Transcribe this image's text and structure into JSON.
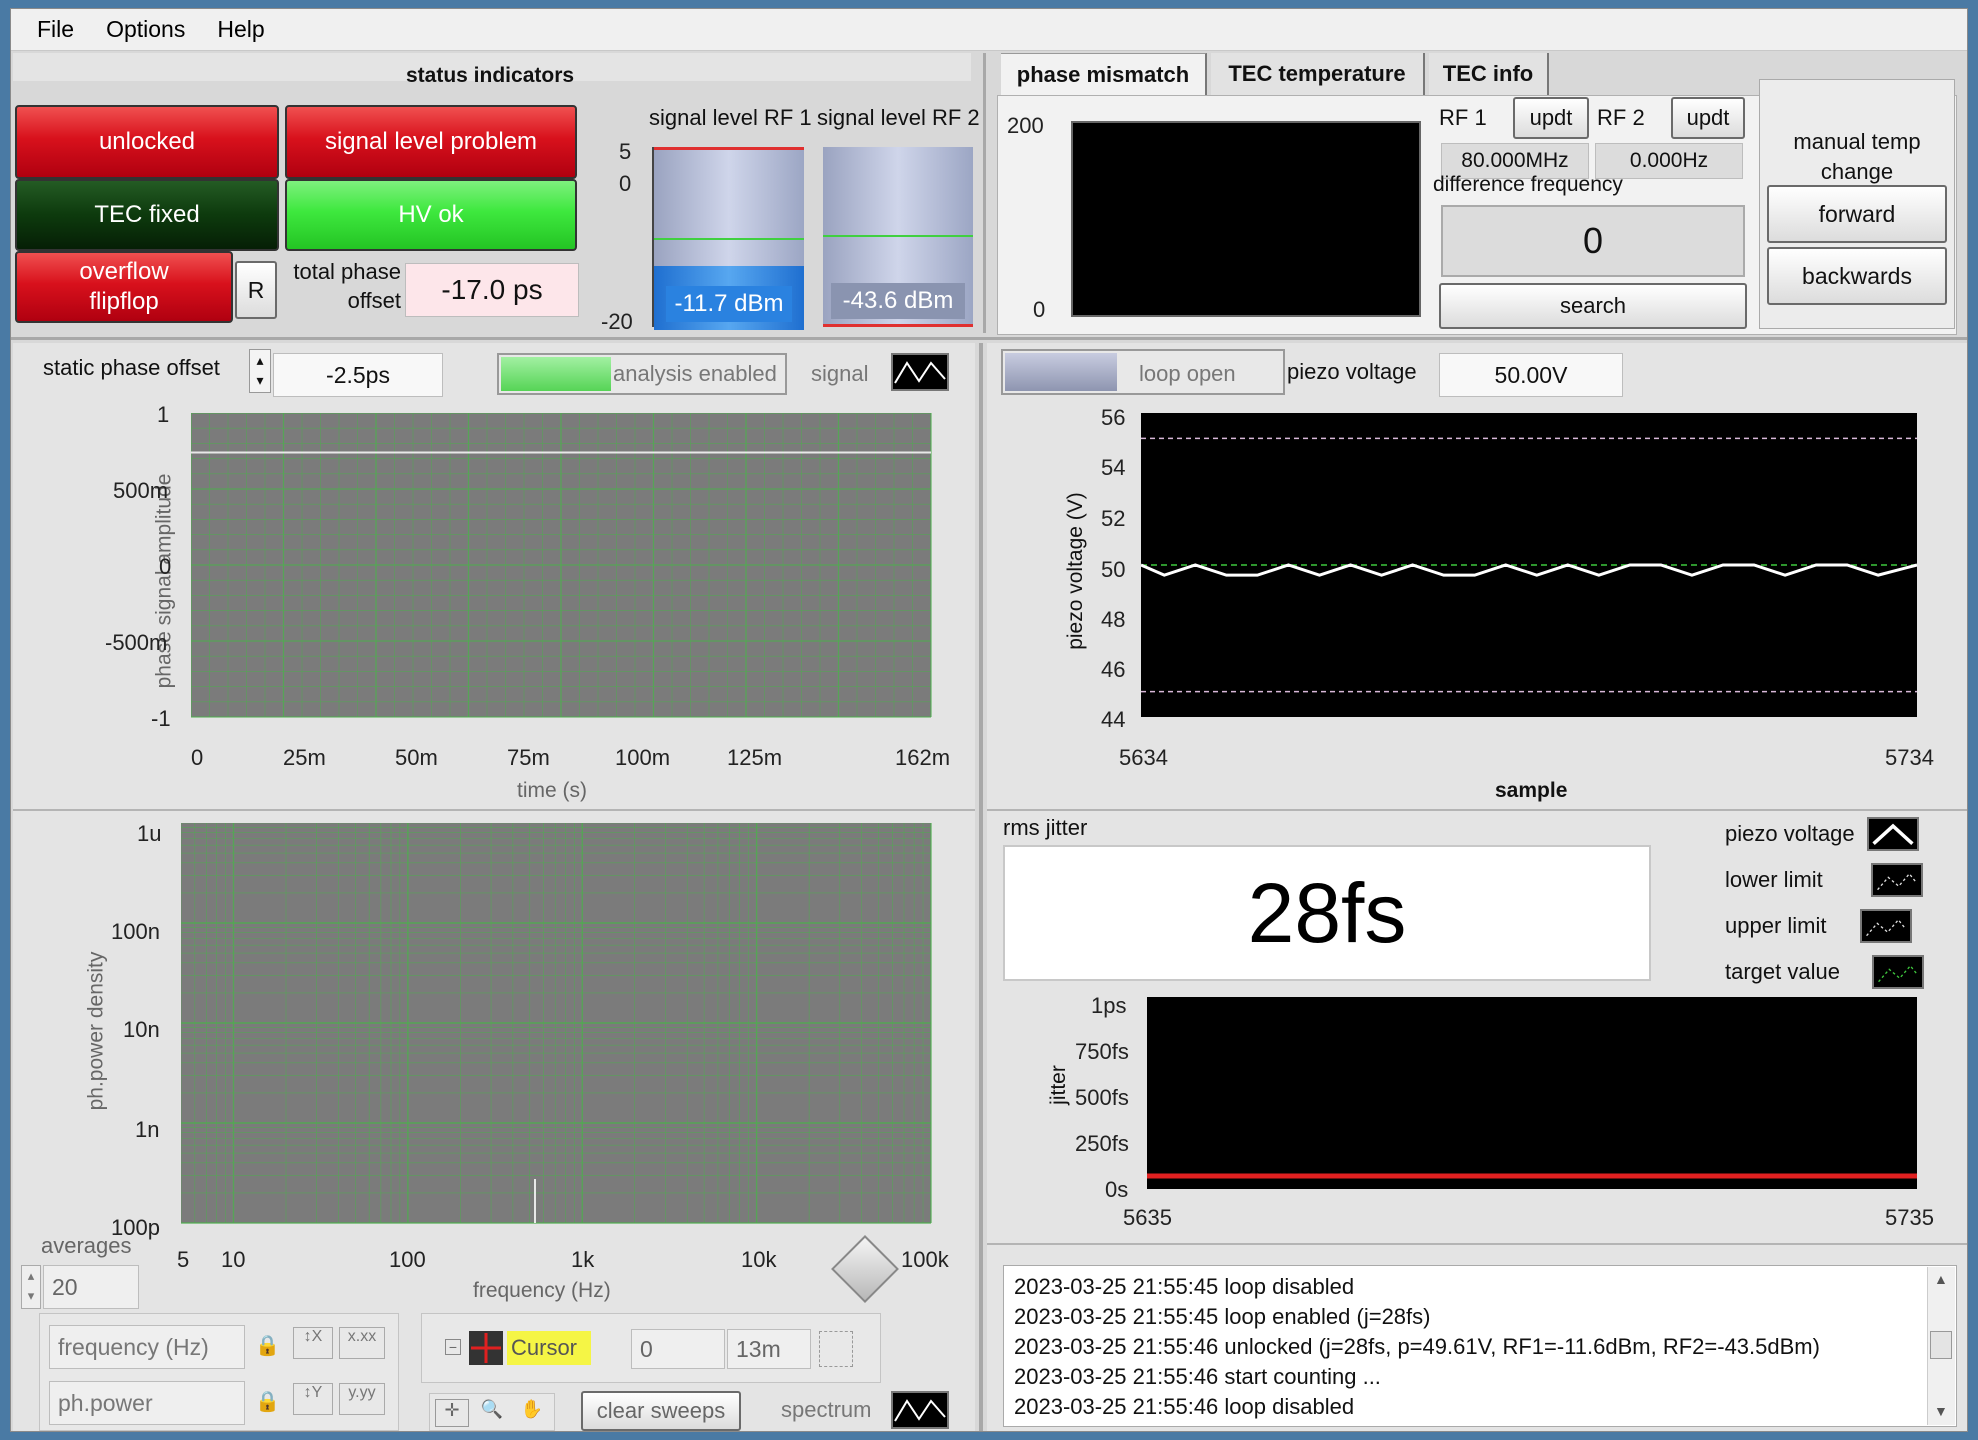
{
  "menu": [
    "File",
    "Options",
    "Help"
  ],
  "status": {
    "title": "status indicators",
    "unlocked": "unlocked",
    "signal_problem": "signal level problem",
    "tec_fixed": "TEC fixed",
    "hv_ok": "HV ok",
    "overflow": "overflow flipflop",
    "reset": "R",
    "total_phase_label": "total phase offset",
    "total_phase_value": "-17.0 ps"
  },
  "signal_levels": {
    "rf1_title": "signal level RF 1",
    "rf2_title": "signal level RF 2",
    "ticks": [
      "5",
      "0",
      "-20"
    ],
    "rf1_value": "-11.7 dBm",
    "rf2_value": "-43.6 dBm"
  },
  "tabs": [
    "phase mismatch",
    "TEC temperature",
    "TEC info"
  ],
  "phase_mismatch": {
    "y_top": "200",
    "y_bottom": "0"
  },
  "rf": {
    "rf1_label": "RF 1",
    "rf2_label": "RF 2",
    "updt": "updt",
    "rf1_value": "80.000MHz",
    "rf2_value": "0.000Hz",
    "diff_label": "difference frequency",
    "diff_value": "0",
    "search": "search"
  },
  "manual": {
    "title": "manual temp change",
    "forward": "forward",
    "backwards": "backwards"
  },
  "controls": {
    "static_label": "static phase offset",
    "static_value": "-2.5ps",
    "analysis": "analysis enabled",
    "signal": "signal",
    "loop_open": "loop open",
    "piezo_label": "piezo voltage",
    "piezo_value": "50.00V"
  },
  "phase_plot": {
    "ylabel": "phase signal amplitude",
    "xlabel": "time (s)",
    "yticks": [
      "1",
      "500m",
      "0",
      "-500m",
      "-1"
    ],
    "xticks": [
      "0",
      "25m",
      "50m",
      "75m",
      "100m",
      "125m",
      "162m"
    ]
  },
  "psd_plot": {
    "ylabel": "ph.power density",
    "xlabel": "frequency (Hz)",
    "yticks": [
      "1u",
      "100n",
      "10n",
      "1n",
      "100p"
    ],
    "xticks": [
      "5",
      "10",
      "100",
      "1k",
      "10k",
      "100k"
    ]
  },
  "bottom_left": {
    "averages_label": "averages",
    "averages_value": "20",
    "freq_axis": "frequency (Hz)",
    "power_axis": "ph.power",
    "cursor_label": "Cursor",
    "cursor_x": "0",
    "cursor_y": "13m",
    "clear_sweeps": "clear sweeps",
    "spectrum": "spectrum"
  },
  "piezo_plot": {
    "ylabel": "piezo voltage (V)",
    "xlabel": "sample",
    "yticks": [
      "56",
      "54",
      "52",
      "50",
      "48",
      "46",
      "44"
    ],
    "xticks": [
      "5634",
      "5734"
    ]
  },
  "rms": {
    "label": "rms jitter",
    "value": "28fs"
  },
  "legend": [
    "piezo voltage",
    "lower limit",
    "upper limit",
    "target value"
  ],
  "jitter_plot": {
    "ylabel": "jitter",
    "yticks": [
      "1ps",
      "750fs",
      "500fs",
      "250fs",
      "0s"
    ],
    "xticks": [
      "5635",
      "5735"
    ]
  },
  "log": [
    "2023-03-25 21:55:45  loop disabled",
    "2023-03-25 21:55:45  loop enabled (j=28fs)",
    "2023-03-25 21:55:46  unlocked (j=28fs, p=49.61V, RF1=-11.6dBm, RF2=-43.5dBm)",
    "2023-03-25 21:55:46  start counting ...",
    "2023-03-25 21:55:46  loop disabled"
  ],
  "chart_data": [
    {
      "type": "line",
      "title": "",
      "xlabel": "sample",
      "ylabel": "piezo voltage (V)",
      "xlim": [
        5634,
        5734
      ],
      "ylim": [
        44,
        56
      ],
      "series": [
        {
          "name": "piezo voltage",
          "x": [
            5634,
            5637,
            5641,
            5645,
            5649,
            5653,
            5657,
            5661,
            5665,
            5669,
            5673,
            5677,
            5681,
            5685,
            5689,
            5693,
            5697,
            5701,
            5705,
            5709,
            5713,
            5717,
            5721,
            5725,
            5729,
            5734
          ],
          "y": [
            50.0,
            49.6,
            50.0,
            49.6,
            49.6,
            50.0,
            49.6,
            50.0,
            49.6,
            50.0,
            49.6,
            49.6,
            50.0,
            49.6,
            50.0,
            49.6,
            50.0,
            50.0,
            49.6,
            50.0,
            50.0,
            49.6,
            50.0,
            50.0,
            49.6,
            50.0
          ]
        },
        {
          "name": "lower limit",
          "x": [
            5634,
            5734
          ],
          "y": [
            45,
            45
          ]
        },
        {
          "name": "upper limit",
          "x": [
            5634,
            5734
          ],
          "y": [
            55,
            55
          ]
        },
        {
          "name": "target value",
          "x": [
            5634,
            5734
          ],
          "y": [
            50,
            50
          ]
        }
      ]
    },
    {
      "type": "line",
      "title": "",
      "xlabel": "time (s)",
      "ylabel": "phase signal amplitude",
      "xlim": [
        0,
        0.162
      ],
      "ylim": [
        -1,
        1
      ],
      "series": [
        {
          "x": [
            0,
            0.162
          ],
          "y": [
            0.74,
            0.74
          ]
        }
      ]
    },
    {
      "type": "line",
      "title": "",
      "xlabel": "",
      "ylabel": "jitter",
      "xlim": [
        5635,
        5735
      ],
      "ylim": [
        0,
        1
      ],
      "series": [
        {
          "x": [
            5635,
            5735
          ],
          "y": [
            0.028,
            0.028
          ]
        }
      ]
    }
  ]
}
